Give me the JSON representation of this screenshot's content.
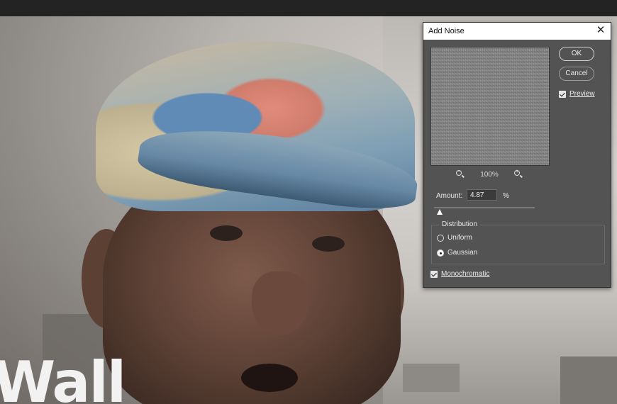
{
  "photo": {
    "overlay_text": "Wall"
  },
  "dialog": {
    "title": "Add Noise",
    "zoom_level": "100%",
    "buttons": {
      "ok_label": "OK",
      "cancel_label": "Cancel"
    },
    "preview": {
      "label": "Preview",
      "checked": true
    },
    "amount": {
      "label": "Amount:",
      "value": "4.87",
      "unit": "%",
      "slider_fraction": 0.0487
    },
    "distribution": {
      "group_label": "Distribution",
      "options": [
        {
          "label": "Uniform",
          "selected": false
        },
        {
          "label": "Gaussian",
          "selected": true
        }
      ]
    },
    "monochromatic": {
      "label": "Monochromatic",
      "checked": true
    }
  },
  "colors": {
    "dialog_bg": "#535353",
    "titlebar_bg": "#ffffff",
    "text": "#eaeaea"
  }
}
